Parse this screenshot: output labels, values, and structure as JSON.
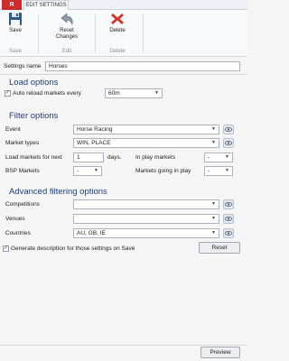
{
  "app": {
    "logo_letter": "R"
  },
  "tabs": {
    "active": "EDIT SETTINGS"
  },
  "ribbon": {
    "save": {
      "label": "Save",
      "group": "Save"
    },
    "reset": {
      "label_line1": "Reset",
      "label_line2": "Changes",
      "group": "Edit"
    },
    "delete": {
      "label": "Delete",
      "group": "Delete"
    }
  },
  "settings_name": {
    "label": "Settings name",
    "value": "Horses"
  },
  "load_options": {
    "title": "Load options",
    "auto_reload": {
      "label": "Auto reload markets every",
      "checked": true,
      "value": "60m"
    }
  },
  "filter_options": {
    "title": "Filter options",
    "event": {
      "label": "Event",
      "value": "Horse Racing"
    },
    "market_types": {
      "label": "Market types",
      "value": "WIN, PLACE"
    },
    "load_next": {
      "label": "Load markets for next",
      "value": "1",
      "unit": "days."
    },
    "in_play": {
      "label": "In play markets",
      "value": "-"
    },
    "bsp": {
      "label": "BSP Markets",
      "value": "-"
    },
    "going_in_play": {
      "label": "Markets going in play",
      "value": "-"
    }
  },
  "advanced": {
    "title": "Advanced filtering options",
    "competitions": {
      "label": "Competitions",
      "value": ""
    },
    "venues": {
      "label": "Venues",
      "value": ""
    },
    "countries": {
      "label": "Countries",
      "value": "AU, GB, IE"
    }
  },
  "generate_description": {
    "label": "Generate description for those settings on Save",
    "checked": true
  },
  "buttons": {
    "reset": "Reset",
    "preview": "Preview"
  },
  "colors": {
    "accent": "#1d3f7a",
    "delete_red": "#d9302b",
    "save_blue": "#2c5a8c"
  }
}
